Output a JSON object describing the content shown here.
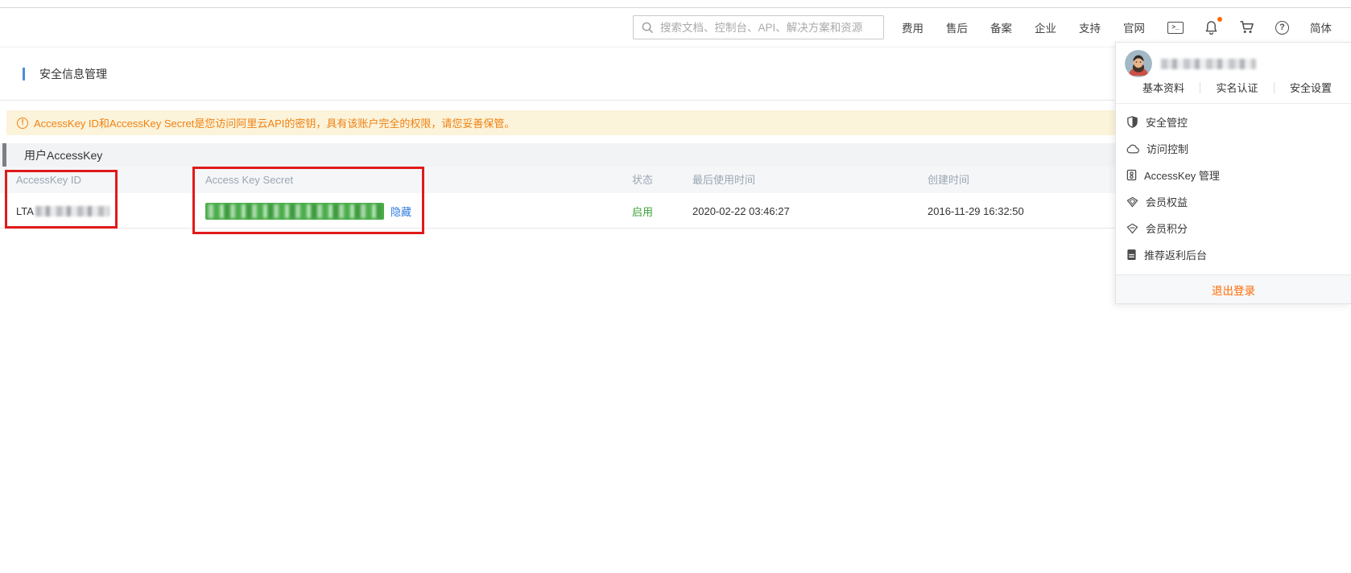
{
  "nav": {
    "search_placeholder": "搜索文档、控制台、API、解决方案和资源",
    "items": [
      "费用",
      "售后",
      "备案",
      "企业",
      "支持",
      "官网"
    ],
    "lang": "简体",
    "bell_has_notification": true
  },
  "page": {
    "title": "安全信息管理",
    "alert_text": "AccessKey ID和AccessKey Secret是您访问阿里云API的密钥，具有该账户完全的权限，请您妥善保管。",
    "section_title": "用户AccessKey"
  },
  "table": {
    "columns": [
      "AccessKey ID",
      "Access Key Secret",
      "状态",
      "最后使用时间",
      "创建时间"
    ],
    "row": {
      "id_prefix": "LTA",
      "id_redacted": true,
      "secret_redacted": true,
      "hide_label": "隐藏",
      "status": "启用",
      "last_used": "2020-02-22 03:46:27",
      "created": "2016-11-29 16:32:50"
    }
  },
  "dropdown": {
    "username_redacted": true,
    "links": [
      "基本资料",
      "实名认证",
      "安全设置"
    ],
    "menu": [
      {
        "icon": "shield-icon",
        "label": "安全管控"
      },
      {
        "icon": "cloud-icon",
        "label": "访问控制"
      },
      {
        "icon": "accesskey-icon",
        "label": "AccessKey 管理"
      },
      {
        "icon": "diamond-icon",
        "label": "会员权益"
      },
      {
        "icon": "points-icon",
        "label": "会员积分"
      },
      {
        "icon": "rebate-icon",
        "label": "推荐返利后台"
      }
    ],
    "logout": "退出登录"
  },
  "colors": {
    "accent_orange": "#ff6a00",
    "alert_bg": "#fbf3da",
    "alert_text": "#f08213",
    "link_blue": "#2e7ce0",
    "status_green": "#3ca23c",
    "secret_green": "#4bad4b",
    "annotation_red": "#e01a1a",
    "title_accent_blue": "#4a90d9"
  }
}
